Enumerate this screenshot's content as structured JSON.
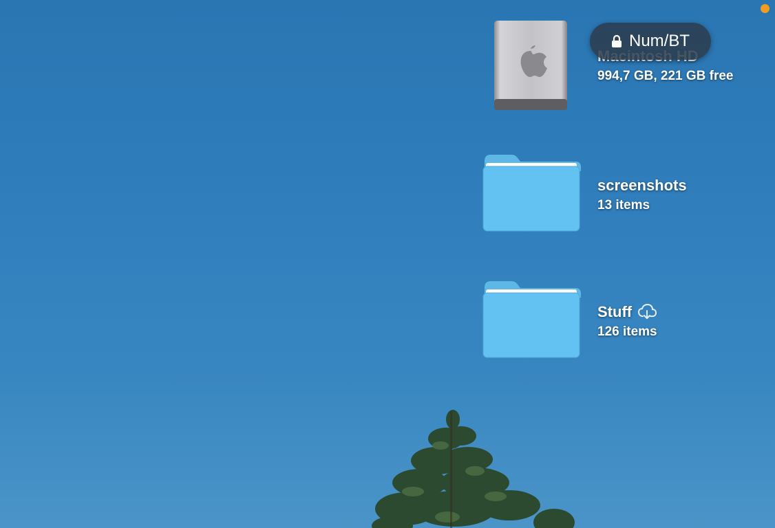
{
  "desktop": {
    "items": [
      {
        "name": "Macintosh HD",
        "info": "994,7 GB, 221 GB free",
        "icon": "hard-drive-icon"
      },
      {
        "name": "screenshots",
        "info": "13 items",
        "icon": "folder-icon"
      },
      {
        "name": "Stuff",
        "info": "126 items",
        "icon": "folder-icon",
        "badge_icon": "icloud-download-icon"
      }
    ]
  },
  "hud": {
    "label": "Num/BT",
    "icon": "lock-icon"
  },
  "status": {
    "indicator_color": "#f39c1f"
  }
}
